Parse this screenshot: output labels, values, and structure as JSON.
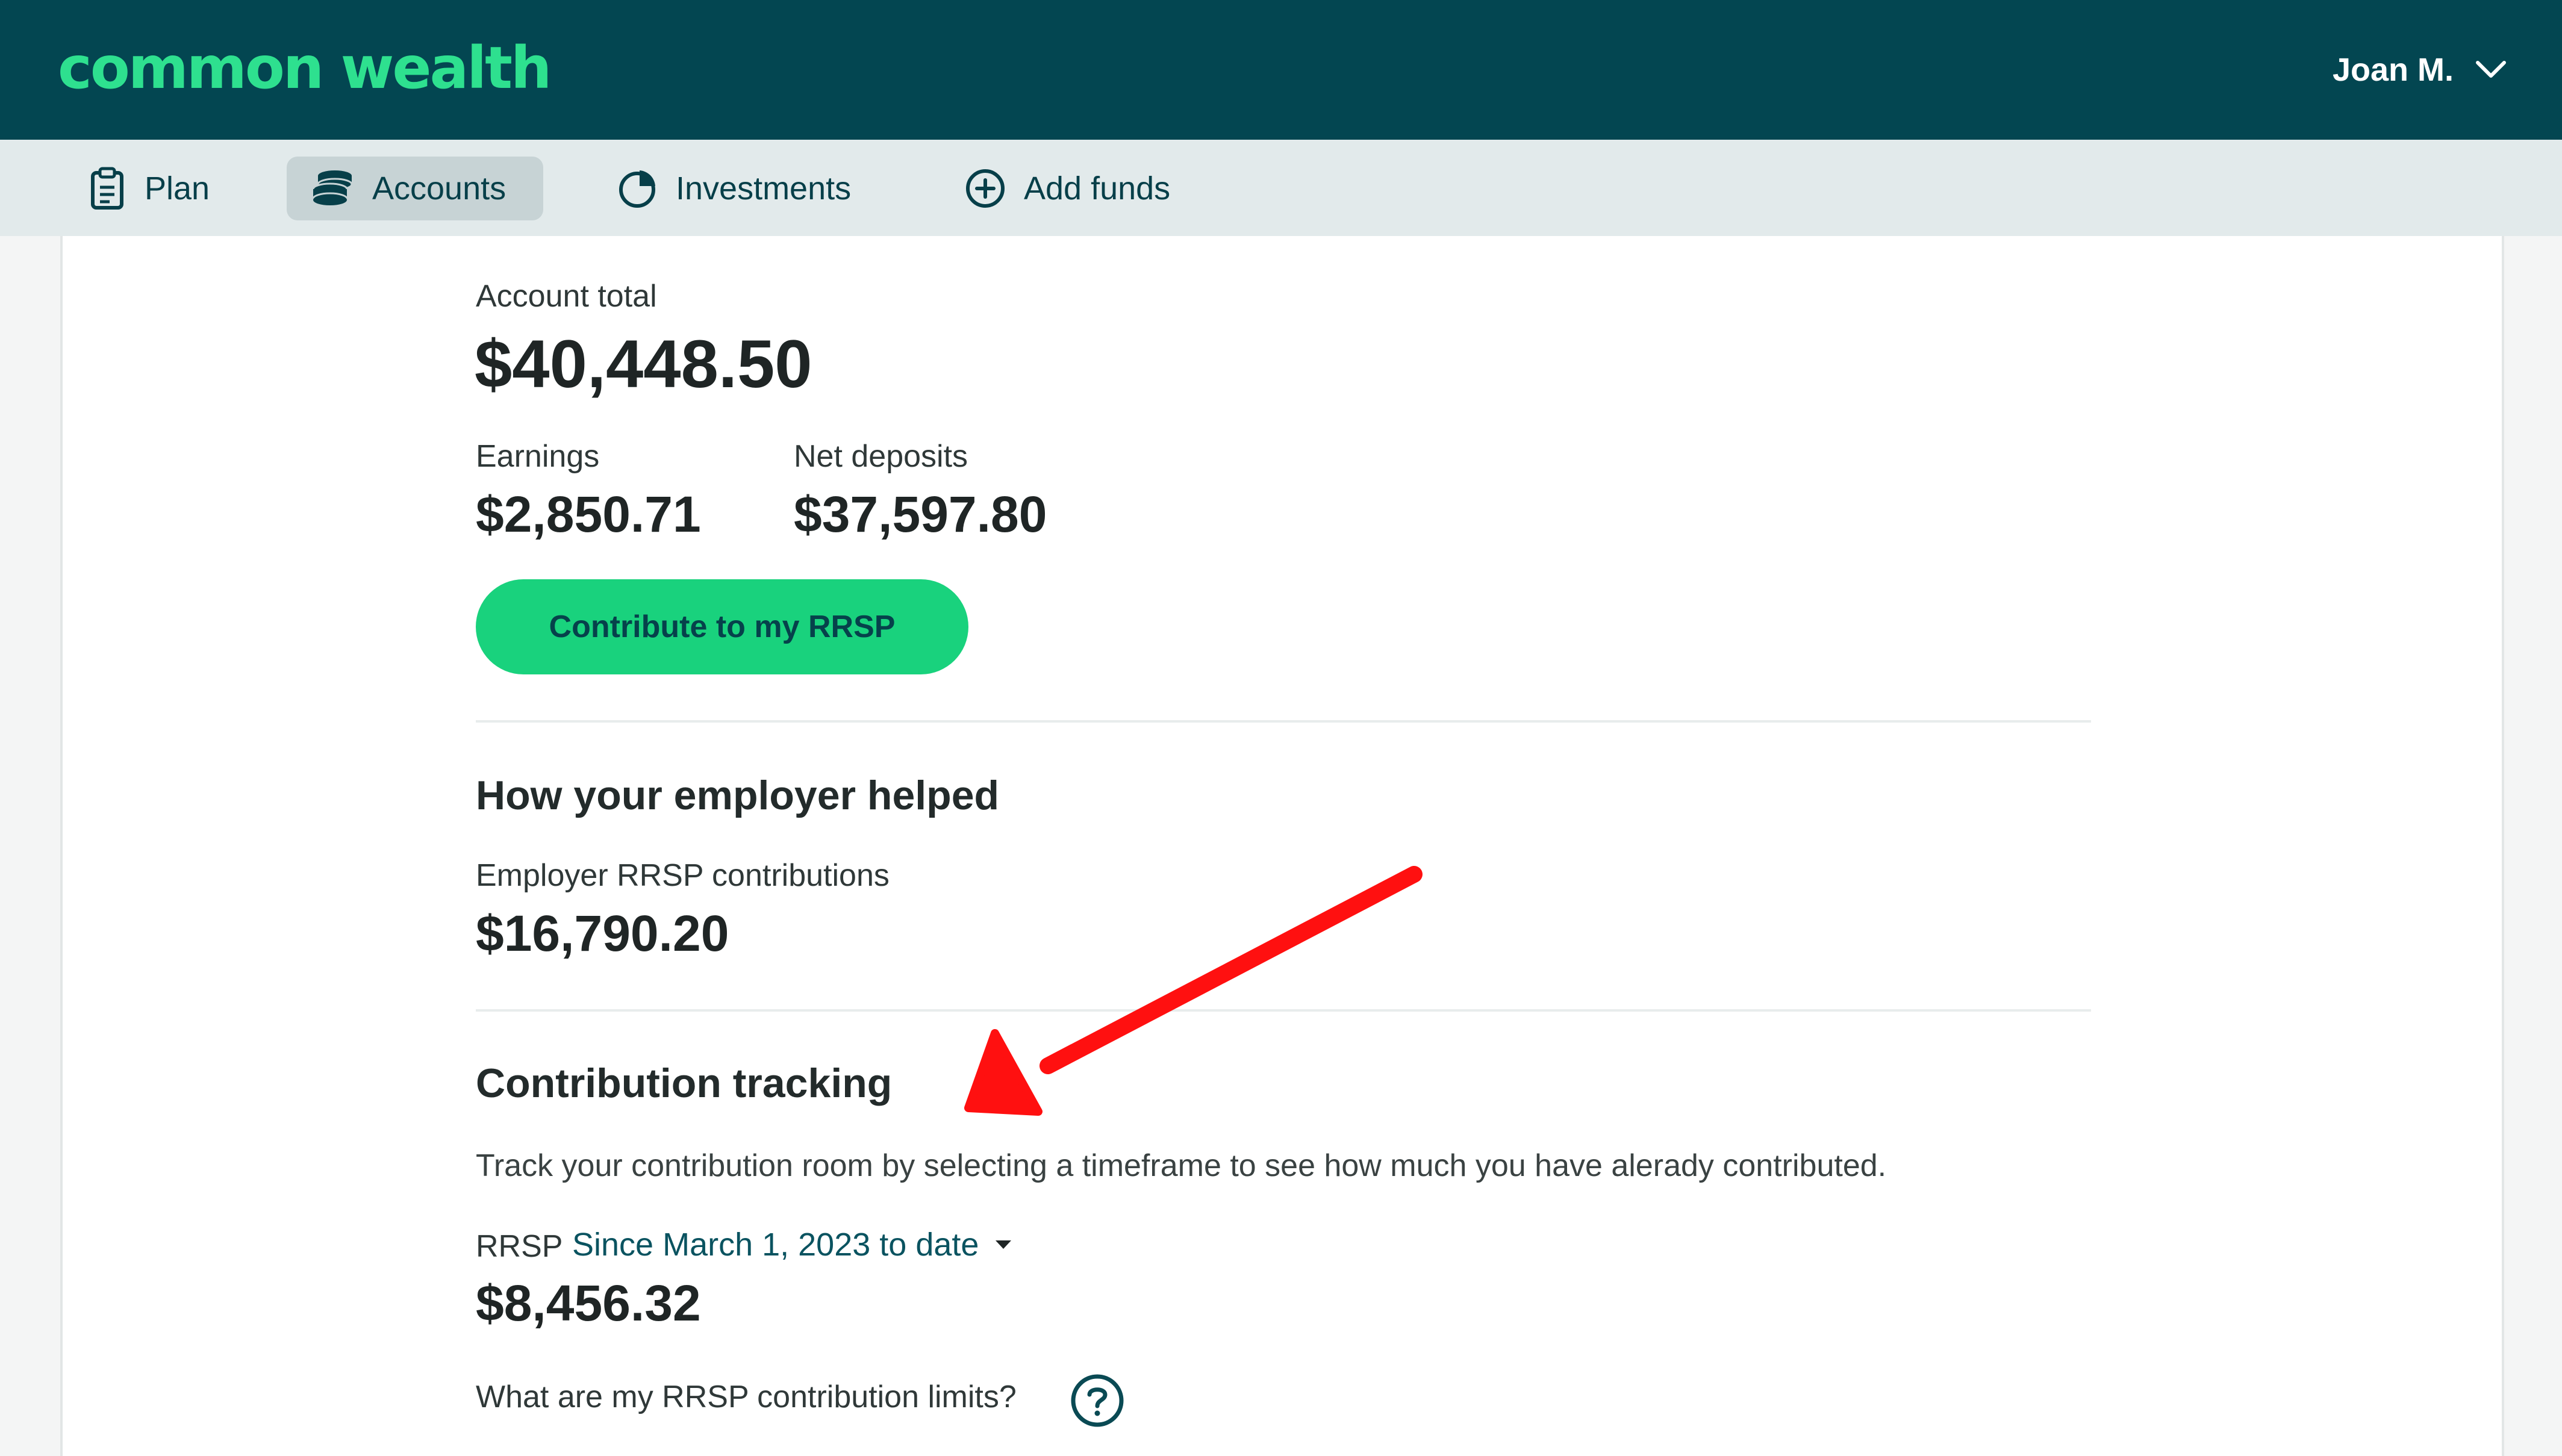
{
  "app": {
    "logo_text": "common wealth",
    "user_name": "Joan M."
  },
  "nav": {
    "items": [
      {
        "label": "Plan",
        "icon": "clipboard-icon"
      },
      {
        "label": "Accounts",
        "icon": "coins-icon",
        "active": true
      },
      {
        "label": "Investments",
        "icon": "pie-chart-icon"
      },
      {
        "label": "Add funds",
        "icon": "plus-circle-icon"
      }
    ]
  },
  "account": {
    "total_label": "Account total",
    "total_value": "$40,448.50",
    "earnings_label": "Earnings",
    "earnings_value": "$2,850.71",
    "net_deposits_label": "Net deposits",
    "net_deposits_value": "$37,597.80",
    "contribute_button": "Contribute to my RRSP"
  },
  "employer": {
    "title": "How your employer helped",
    "contributions_label": "Employer RRSP contributions",
    "contributions_value": "$16,790.20"
  },
  "tracking": {
    "title": "Contribution tracking",
    "description": "Track your contribution room by selecting a timeframe to see how much you have alerady contributed.",
    "account_type": "RRSP",
    "timeframe": "Since March 1, 2023 to date",
    "amount": "$8,456.32",
    "limits_question": "What are my RRSP contribution limits?"
  },
  "colors": {
    "header_bg": "#034651",
    "nav_bg": "#e2eaeb",
    "accent_green": "#19d27d",
    "logo_green": "#2ee08f",
    "annotation_red": "#ff1010"
  }
}
